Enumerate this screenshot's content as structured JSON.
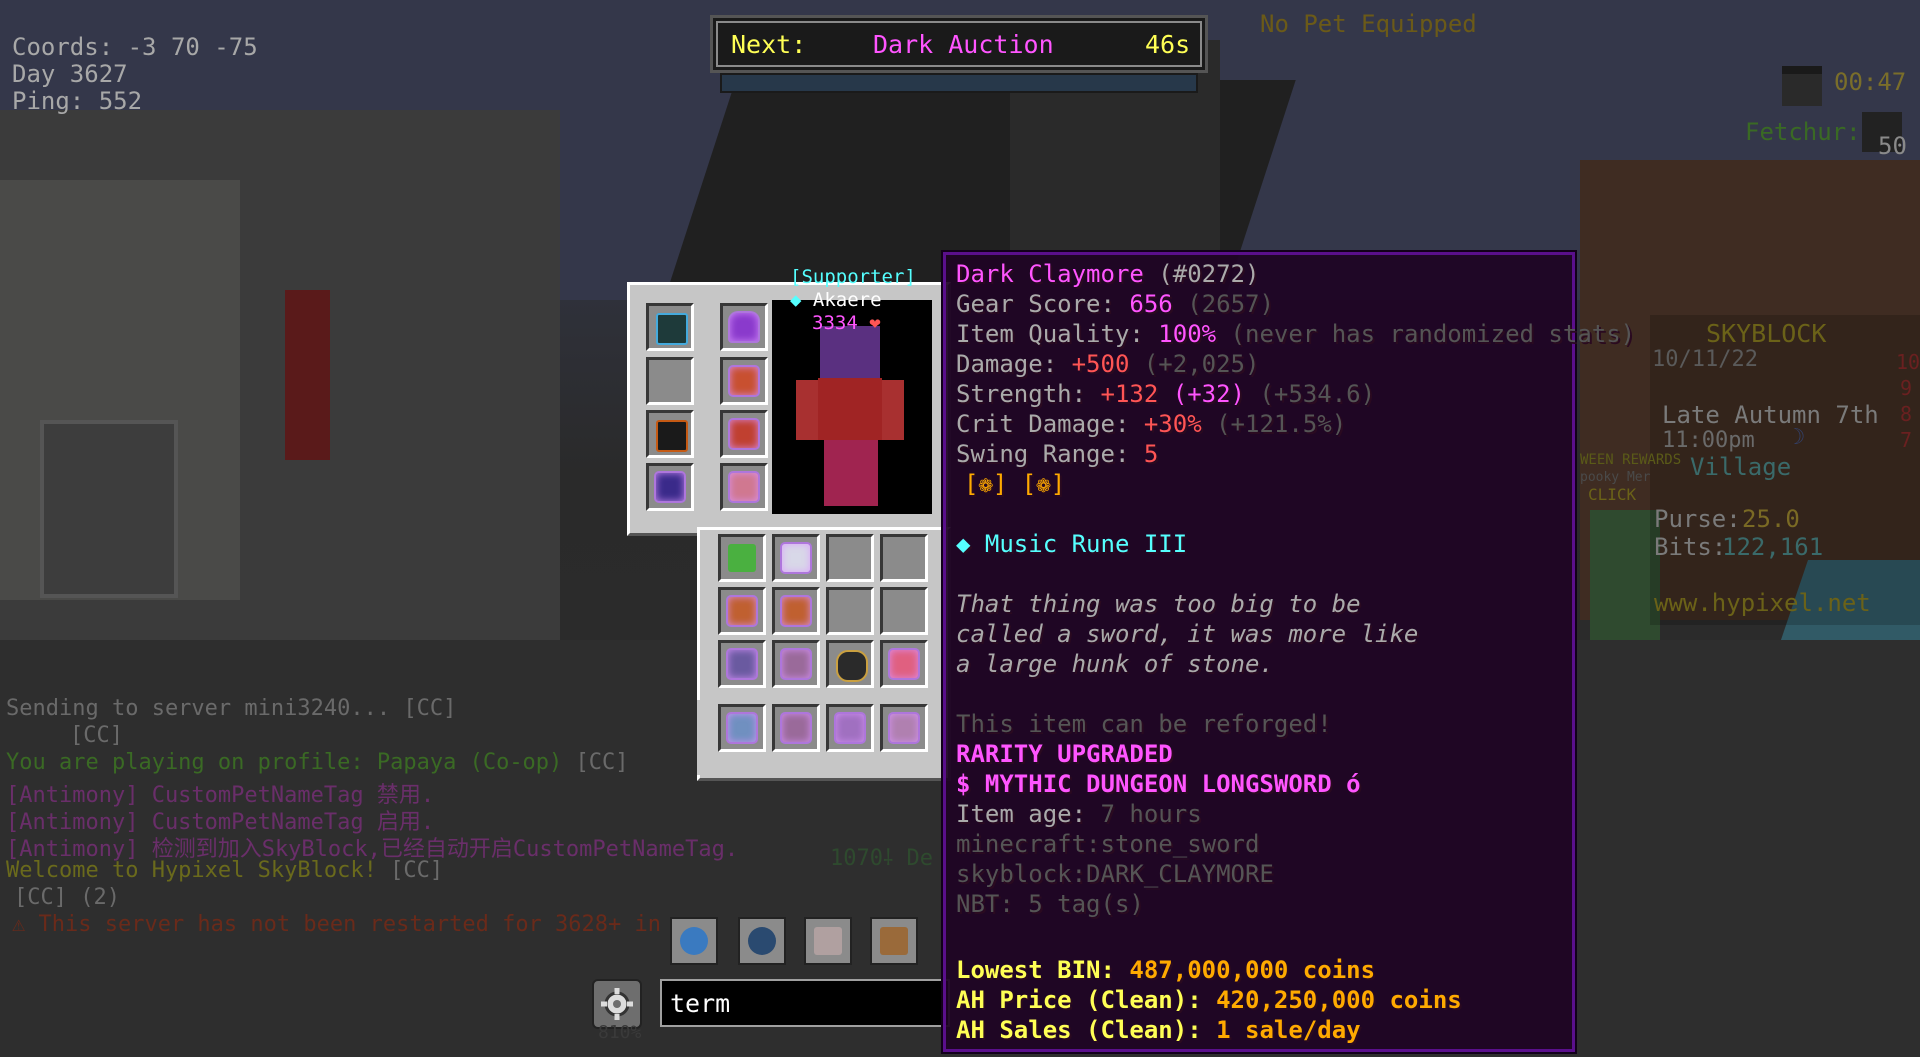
{
  "hud": {
    "coords": "Coords: -3 70 -75",
    "day": "Day 3627",
    "ping": "Ping: 552",
    "pet": "No Pet Equipped",
    "next_label": "Next:",
    "next_event": "Dark Auction",
    "next_timer": "46s",
    "clock": "00:47",
    "fetchur_label": "Fetchur:",
    "fetchur_count": "50"
  },
  "scoreboard": {
    "title": "SKYBLOCK",
    "date": "10/11/22",
    "season": "Late Autumn 7th",
    "time": "11:00pm",
    "location": "Village",
    "purse_label": "Purse:",
    "purse_value": "25.0",
    "bits_label": "Bits:",
    "bits_value": "122,161",
    "url": "www.hypixel.net",
    "npc_text_1": "WEEN REWARDS",
    "npc_text_2": "pooky Mer",
    "npc_text_3": "CLICK",
    "side_numbers": [
      "10",
      "9",
      "8",
      "7"
    ]
  },
  "chat": {
    "lines": [
      {
        "text": "Sending to server mini3240...",
        "tag": "[CC]",
        "color": "#6a6a6a"
      },
      {
        "text": "",
        "tag": "[CC]",
        "color": "#6a6a6a"
      },
      {
        "text": "You are playing on profile: Papaya (Co-op)",
        "tag": "[CC]",
        "color": "#3a6a24"
      },
      {
        "text": "[Antimony] CustomPetNameTag 禁用.",
        "tag": "",
        "color": "#6a2e6a"
      },
      {
        "text": "[Antimony] CustomPetNameTag 启用.",
        "tag": "",
        "color": "#6a2e6a"
      },
      {
        "text": "[Antimony] 检测到加入SkyBlock,已经自动开启CustomPetNameTag.",
        "tag": "",
        "color": "#6a2e6a"
      },
      {
        "text": "Welcome to Hypixel SkyBlock!",
        "tag": "[CC]",
        "color": "#6a6a1c"
      },
      {
        "text": "[CC] (2)",
        "tag": "",
        "color": "#6a6a6a"
      },
      {
        "text": "⚠ This server has not been restarted for 3628+ in",
        "tag": "",
        "color": "#6a2a1a"
      }
    ],
    "faded_bottom": "1070⸸ De"
  },
  "player": {
    "tag": "[Supporter]",
    "name": "Akaere",
    "health": "3334",
    "heart_icon": "heart-icon"
  },
  "tooltip": {
    "title": "Dark Claymore",
    "title_id": "(#0272)",
    "gear_score_label": "Gear Score:",
    "gear_score": "656",
    "gear_score_extra": "(2657)",
    "quality_label": "Item Quality:",
    "quality": "100%",
    "quality_extra": "(never has randomized stats)",
    "damage_label": "Damage:",
    "damage": "+500",
    "damage_extra": "(+2,025)",
    "strength_label": "Strength:",
    "strength": "+132",
    "strength_bonus": "(+32)",
    "strength_extra": "(+534.6)",
    "crit_label": "Crit Damage:",
    "crit": "+30%",
    "crit_extra": "(+121.5%)",
    "swing_label": "Swing Range:",
    "swing": "5",
    "gems": "[❁] [❁]",
    "rune": "◆ Music Rune III",
    "lore_1": "That thing was too big to be",
    "lore_2": "called a sword, it was more like",
    "lore_3": "a large hunk of stone.",
    "reforge": "This item can be reforged!",
    "rarity_upgraded": "RARITY UPGRADED",
    "rarity": "$ MYTHIC DUNGEON LONGSWORD ό",
    "age_label": "Item age:",
    "age": "7 hours",
    "mc_id": "minecraft:stone_sword",
    "sb_id": "skyblock:DARK_CLAYMORE",
    "nbt": "NBT: 5 tag(s)",
    "lbin_label": "Lowest BIN:",
    "lbin": "487,000,000 coins",
    "ah_label": "AH Price (Clean):",
    "ah": "420,250,000 coins",
    "sales_label": "AH Sales (Clean):",
    "sales": "1 sale/day"
  },
  "search": {
    "value": "term",
    "below": "810%"
  },
  "colors": {
    "hud_gray": "#a8a8a8",
    "gold": "#ffaa00",
    "yellow": "#ffff55",
    "light_purple": "#ff55ff",
    "red": "#ff5555",
    "aqua": "#55ffff",
    "gray": "#aaaaaa",
    "dark_gray": "#555555",
    "white": "#ffffff"
  }
}
